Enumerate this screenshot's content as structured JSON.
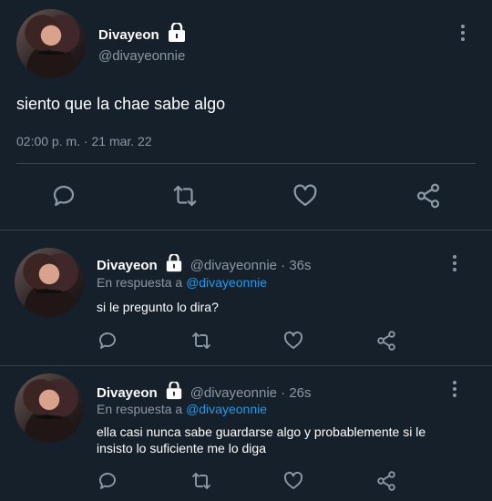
{
  "main_tweet": {
    "display_name": "Divayeon",
    "handle": "@divayeonnie",
    "text": "siento que la chae sabe algo",
    "timestamp": "02:00 p. m. · 21 mar. 22"
  },
  "replies": [
    {
      "display_name": "Divayeon",
      "meta": "@divayeonnie · 36s",
      "reply_prefix": "En respuesta a",
      "reply_to": "@divayeonnie",
      "text": "si le pregunto lo dira?"
    },
    {
      "display_name": "Divayeon",
      "meta": "@divayeonnie · 26s",
      "reply_prefix": "En respuesta a",
      "reply_to": "@divayeonnie",
      "text": "ella casi nunca sabe guardarse algo y probablemente si le insisto lo suficiente me lo diga"
    }
  ],
  "icons": [
    "reply-icon",
    "retweet-icon",
    "like-icon",
    "share-icon",
    "lock-icon",
    "more-options-icon"
  ],
  "colors": {
    "background": "#15202b",
    "muted": "#8b98a5",
    "link": "#1d9bf0",
    "divider": "#38444d"
  }
}
